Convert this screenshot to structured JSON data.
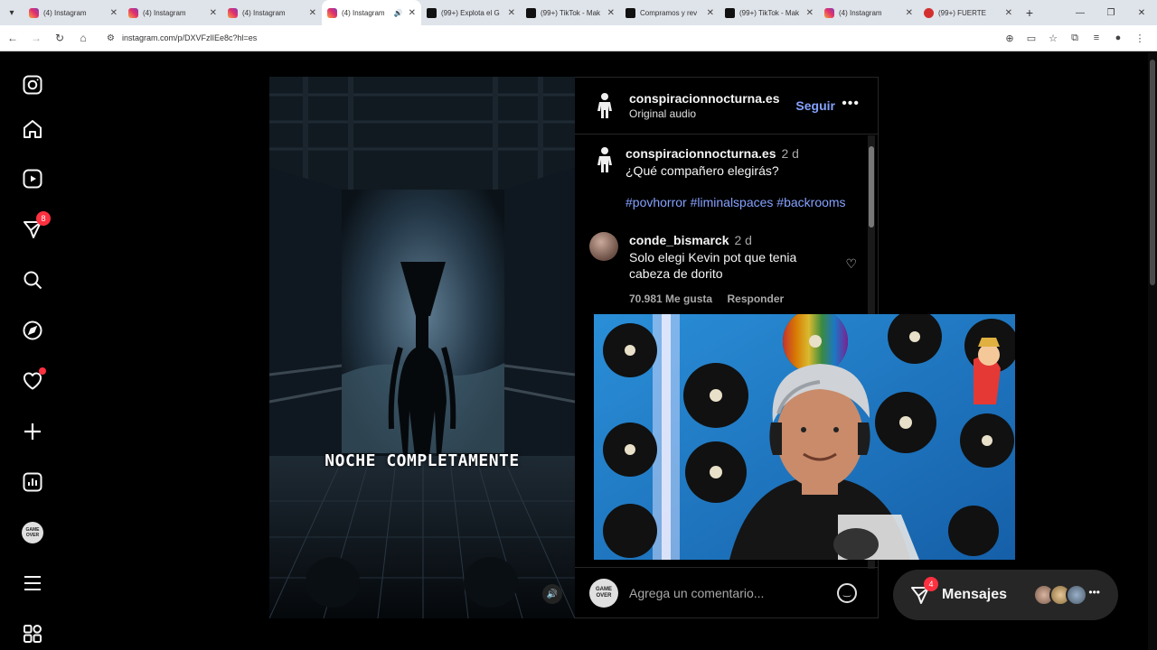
{
  "browser": {
    "tabs": [
      {
        "title": "(4) Instagram",
        "favicon": "ig",
        "active": false
      },
      {
        "title": "(4) Instagram",
        "favicon": "ig",
        "active": false
      },
      {
        "title": "(4) Instagram",
        "favicon": "ig",
        "active": false
      },
      {
        "title": "(4) Instagram",
        "favicon": "ig",
        "active": true,
        "audio": true
      },
      {
        "title": "(99+) Explota el G",
        "favicon": "tt",
        "active": false
      },
      {
        "title": "(99+) TikTok - Mak",
        "favicon": "tt",
        "active": false
      },
      {
        "title": "Compramos y rev",
        "favicon": "tt",
        "active": false
      },
      {
        "title": "(99+) TikTok - Mak",
        "favicon": "tt",
        "active": false
      },
      {
        "title": "(4) Instagram",
        "favicon": "ig",
        "active": false
      },
      {
        "title": "(99+) FUERTE",
        "favicon": "red",
        "active": false
      }
    ],
    "url": "instagram.com/p/DXVFzlIEe8c?hl=es"
  },
  "leftnav": {
    "notifications_badge": "8",
    "messages_badge": "4"
  },
  "post": {
    "overlay_text": "NOCHE COMPLETAMENTE",
    "header": {
      "username": "conspiracionnocturna.es",
      "audio": "Original audio",
      "follow_label": "Seguir"
    },
    "caption": {
      "username": "conspiracionnocturna.es",
      "time": "2 d",
      "text": "¿Qué compañero elegirás?",
      "hashtags": "#povhorror #liminalspaces #backrooms"
    },
    "comments": [
      {
        "username": "conde_bismarck",
        "time": "2 d",
        "text_line1": "Solo elegi Kevin pot que tenia",
        "text_line2": "cabeza de dorito",
        "likes": "70.981 Me gusta",
        "reply_label": "Responder"
      }
    ],
    "add_comment_placeholder": "Agrega un comentario..."
  },
  "messages": {
    "label": "Mensajes",
    "badge": "4"
  },
  "colors": {
    "accent_link": "#85a1ff",
    "badge_red": "#ff3040",
    "background": "#000000"
  }
}
